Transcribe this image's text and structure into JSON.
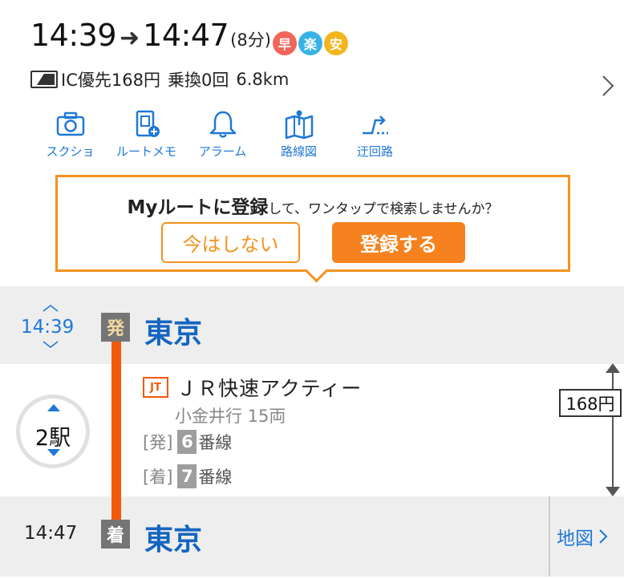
{
  "summary": {
    "depart_time": "14:39",
    "arrow": "➜",
    "arrive_time": "14:47",
    "duration": "(8分)",
    "badges": [
      {
        "label": "早",
        "color": "#f2665a"
      },
      {
        "label": "楽",
        "color": "#39b3e6"
      },
      {
        "label": "安",
        "color": "#f2b51c"
      }
    ],
    "fare_mode": "IC優先",
    "fare": "168円",
    "transfers": "乗換0回",
    "distance": "6.8km"
  },
  "actions": [
    {
      "label": "スクショ",
      "icon": "camera-icon"
    },
    {
      "label": "ルートメモ",
      "icon": "memo-add-icon"
    },
    {
      "label": "アラーム",
      "icon": "bell-icon"
    },
    {
      "label": "路線図",
      "icon": "route-map-icon"
    },
    {
      "label": "迂回路",
      "icon": "detour-icon"
    }
  ],
  "promo": {
    "title_bold": "Myルートに登録",
    "title_rest": "して、ワンタップで検索しませんか？",
    "decline_label": "今はしない",
    "register_label": "登録する"
  },
  "route": {
    "departure": {
      "time": "14:39",
      "tag": "発",
      "station": "東京"
    },
    "arrival": {
      "time": "14:47",
      "tag": "着",
      "station": "東京"
    },
    "line_color": "#f25a0a",
    "stops": "2駅",
    "company_mark": "JT",
    "train_name": "ＪＲ快速アクティー",
    "train_sub": "小金井行 15両",
    "dep_platform": {
      "prefix": "[発]",
      "number": "6",
      "suffix": "番線"
    },
    "arr_platform": {
      "prefix": "[着]",
      "number": "7",
      "suffix": "番線"
    },
    "fare": "168円",
    "map_label": "地図"
  }
}
